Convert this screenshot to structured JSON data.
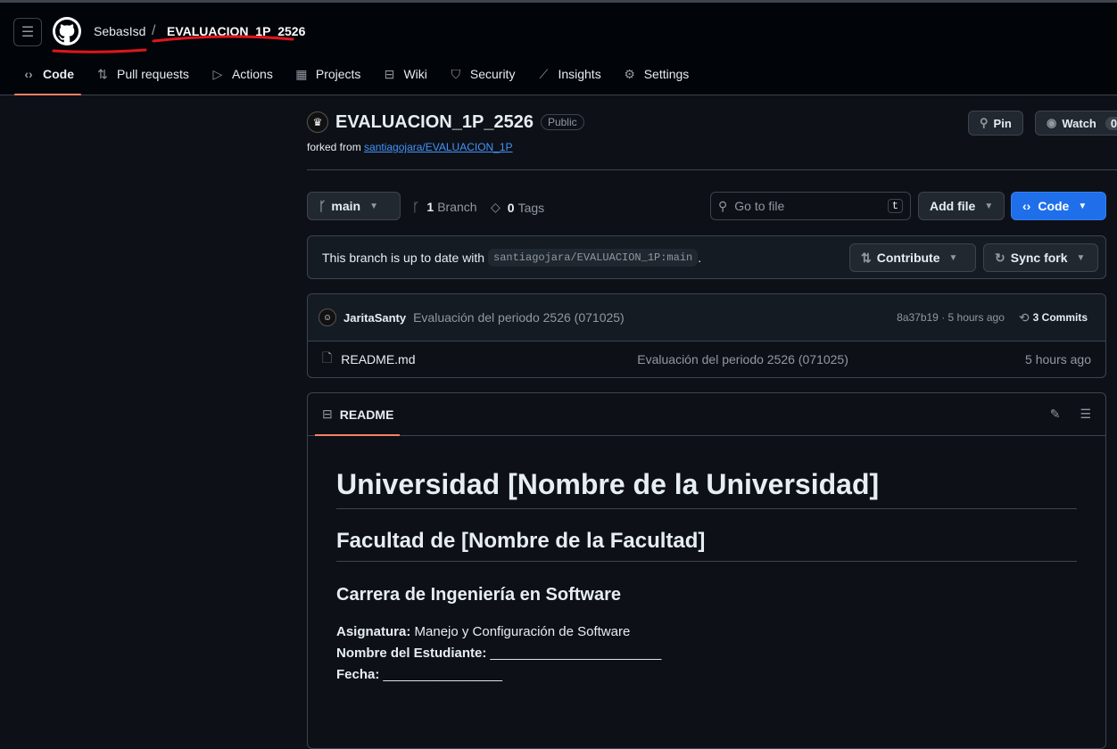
{
  "header": {
    "owner": "SebasIsd",
    "separator": "/",
    "repo": "EVALUACION_1P_2526"
  },
  "nav": [
    {
      "label": "Code",
      "icon": "code-icon"
    },
    {
      "label": "Pull requests",
      "icon": "pull-request-icon"
    },
    {
      "label": "Actions",
      "icon": "play-icon"
    },
    {
      "label": "Projects",
      "icon": "table-icon"
    },
    {
      "label": "Wiki",
      "icon": "book-icon"
    },
    {
      "label": "Security",
      "icon": "shield-icon"
    },
    {
      "label": "Insights",
      "icon": "graph-icon"
    },
    {
      "label": "Settings",
      "icon": "gear-icon"
    }
  ],
  "repo": {
    "name": "EVALUACION_1P_2526",
    "visibility": "Public",
    "forked_prefix": "forked from",
    "forked_link": "santiagojara/EVALUACION_1P",
    "pin": "Pin",
    "watch": "Watch",
    "watch_count": "0"
  },
  "toolbar": {
    "branch": "main",
    "branch_count": "1",
    "branch_label": "Branch",
    "tag_count": "0",
    "tag_label": "Tags",
    "search_placeholder": "Go to file",
    "search_key": "t",
    "add_file": "Add file",
    "code": "Code"
  },
  "fork_status": {
    "text": "This branch is up to date with",
    "ref": "santiagojara/EVALUACION_1P:main",
    "period": ".",
    "contribute": "Contribute",
    "sync": "Sync fork"
  },
  "commit": {
    "author": "JaritaSanty",
    "message": "Evaluación del periodo 2526 (071025)",
    "sha_time": "8a37b19 · 5 hours ago",
    "commits": "3 Commits"
  },
  "files": [
    {
      "name": "README.md",
      "message": "Evaluación del periodo 2526 (071025)",
      "time": "5 hours ago"
    }
  ],
  "readme": {
    "tab": "README",
    "h1": "Universidad [Nombre de la Universidad]",
    "h2": "Facultad de [Nombre de la Facultad]",
    "h3": "Carrera de Ingeniería en Software",
    "lines": [
      {
        "label": "Asignatura:",
        "value": " Manejo y Configuración de Software"
      },
      {
        "label": "Nombre del Estudiante:",
        "value": " _______________________"
      },
      {
        "label": "Fecha:",
        "value": " ________________"
      }
    ]
  }
}
